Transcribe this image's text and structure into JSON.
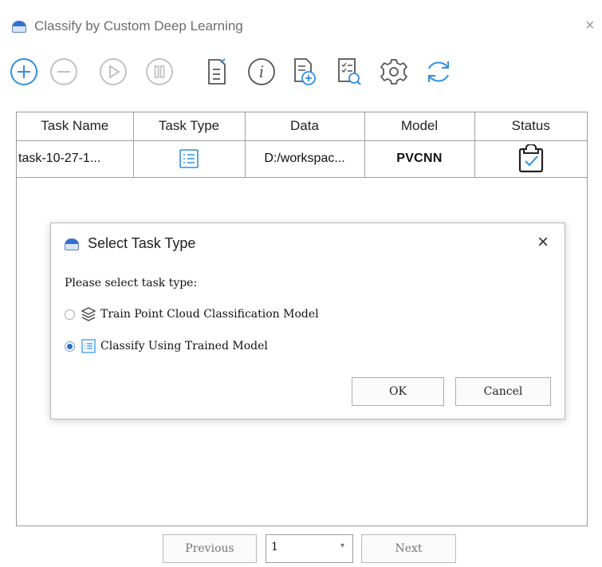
{
  "window": {
    "title": "Classify by Custom Deep Learning",
    "close_glyph": "×",
    "logo_icon": "app-logo-icon"
  },
  "toolbar": {
    "buttons": [
      {
        "name": "add",
        "icon": "plus-circle-icon",
        "enabled": true
      },
      {
        "name": "remove",
        "icon": "minus-circle-icon",
        "enabled": false
      },
      {
        "name": "start",
        "icon": "play-circle-icon",
        "enabled": false
      },
      {
        "name": "pause",
        "icon": "pause-circle-icon",
        "enabled": false
      },
      {
        "name": "edit",
        "icon": "edit-document-icon",
        "enabled": true
      },
      {
        "name": "info",
        "icon": "info-icon",
        "enabled": true
      },
      {
        "name": "add-document",
        "icon": "add-document-icon",
        "enabled": true
      },
      {
        "name": "view-log",
        "icon": "checklist-search-icon",
        "enabled": true
      },
      {
        "name": "settings",
        "icon": "gear-icon",
        "enabled": true
      },
      {
        "name": "refresh",
        "icon": "refresh-icon",
        "enabled": true
      }
    ],
    "accent": "#2f8fe6",
    "disabled": "#c2c2c2"
  },
  "table": {
    "columns": [
      "Task Name",
      "Task Type",
      "Data",
      "Model",
      "Status"
    ],
    "rows": [
      {
        "task_name": "task-10-27-1...",
        "task_type_icon": "list-icon",
        "data": "D:/workspac...",
        "model": "PVCNN",
        "status_icon": "clipboard-check-icon"
      }
    ]
  },
  "dialog": {
    "title": "Select Task Type",
    "close_glyph": "×",
    "prompt": "Please select task type:",
    "options": [
      {
        "label": "Train Point Cloud Classification Model",
        "icon": "layers-icon",
        "selected": false
      },
      {
        "label": "Classify Using Trained Model",
        "icon": "list-icon",
        "selected": true
      }
    ],
    "ok_label": "OK",
    "cancel_label": "Cancel"
  },
  "pager": {
    "previous_label": "Previous",
    "page_value": "1",
    "dropdown_glyph": "▾",
    "next_label": "Next"
  }
}
